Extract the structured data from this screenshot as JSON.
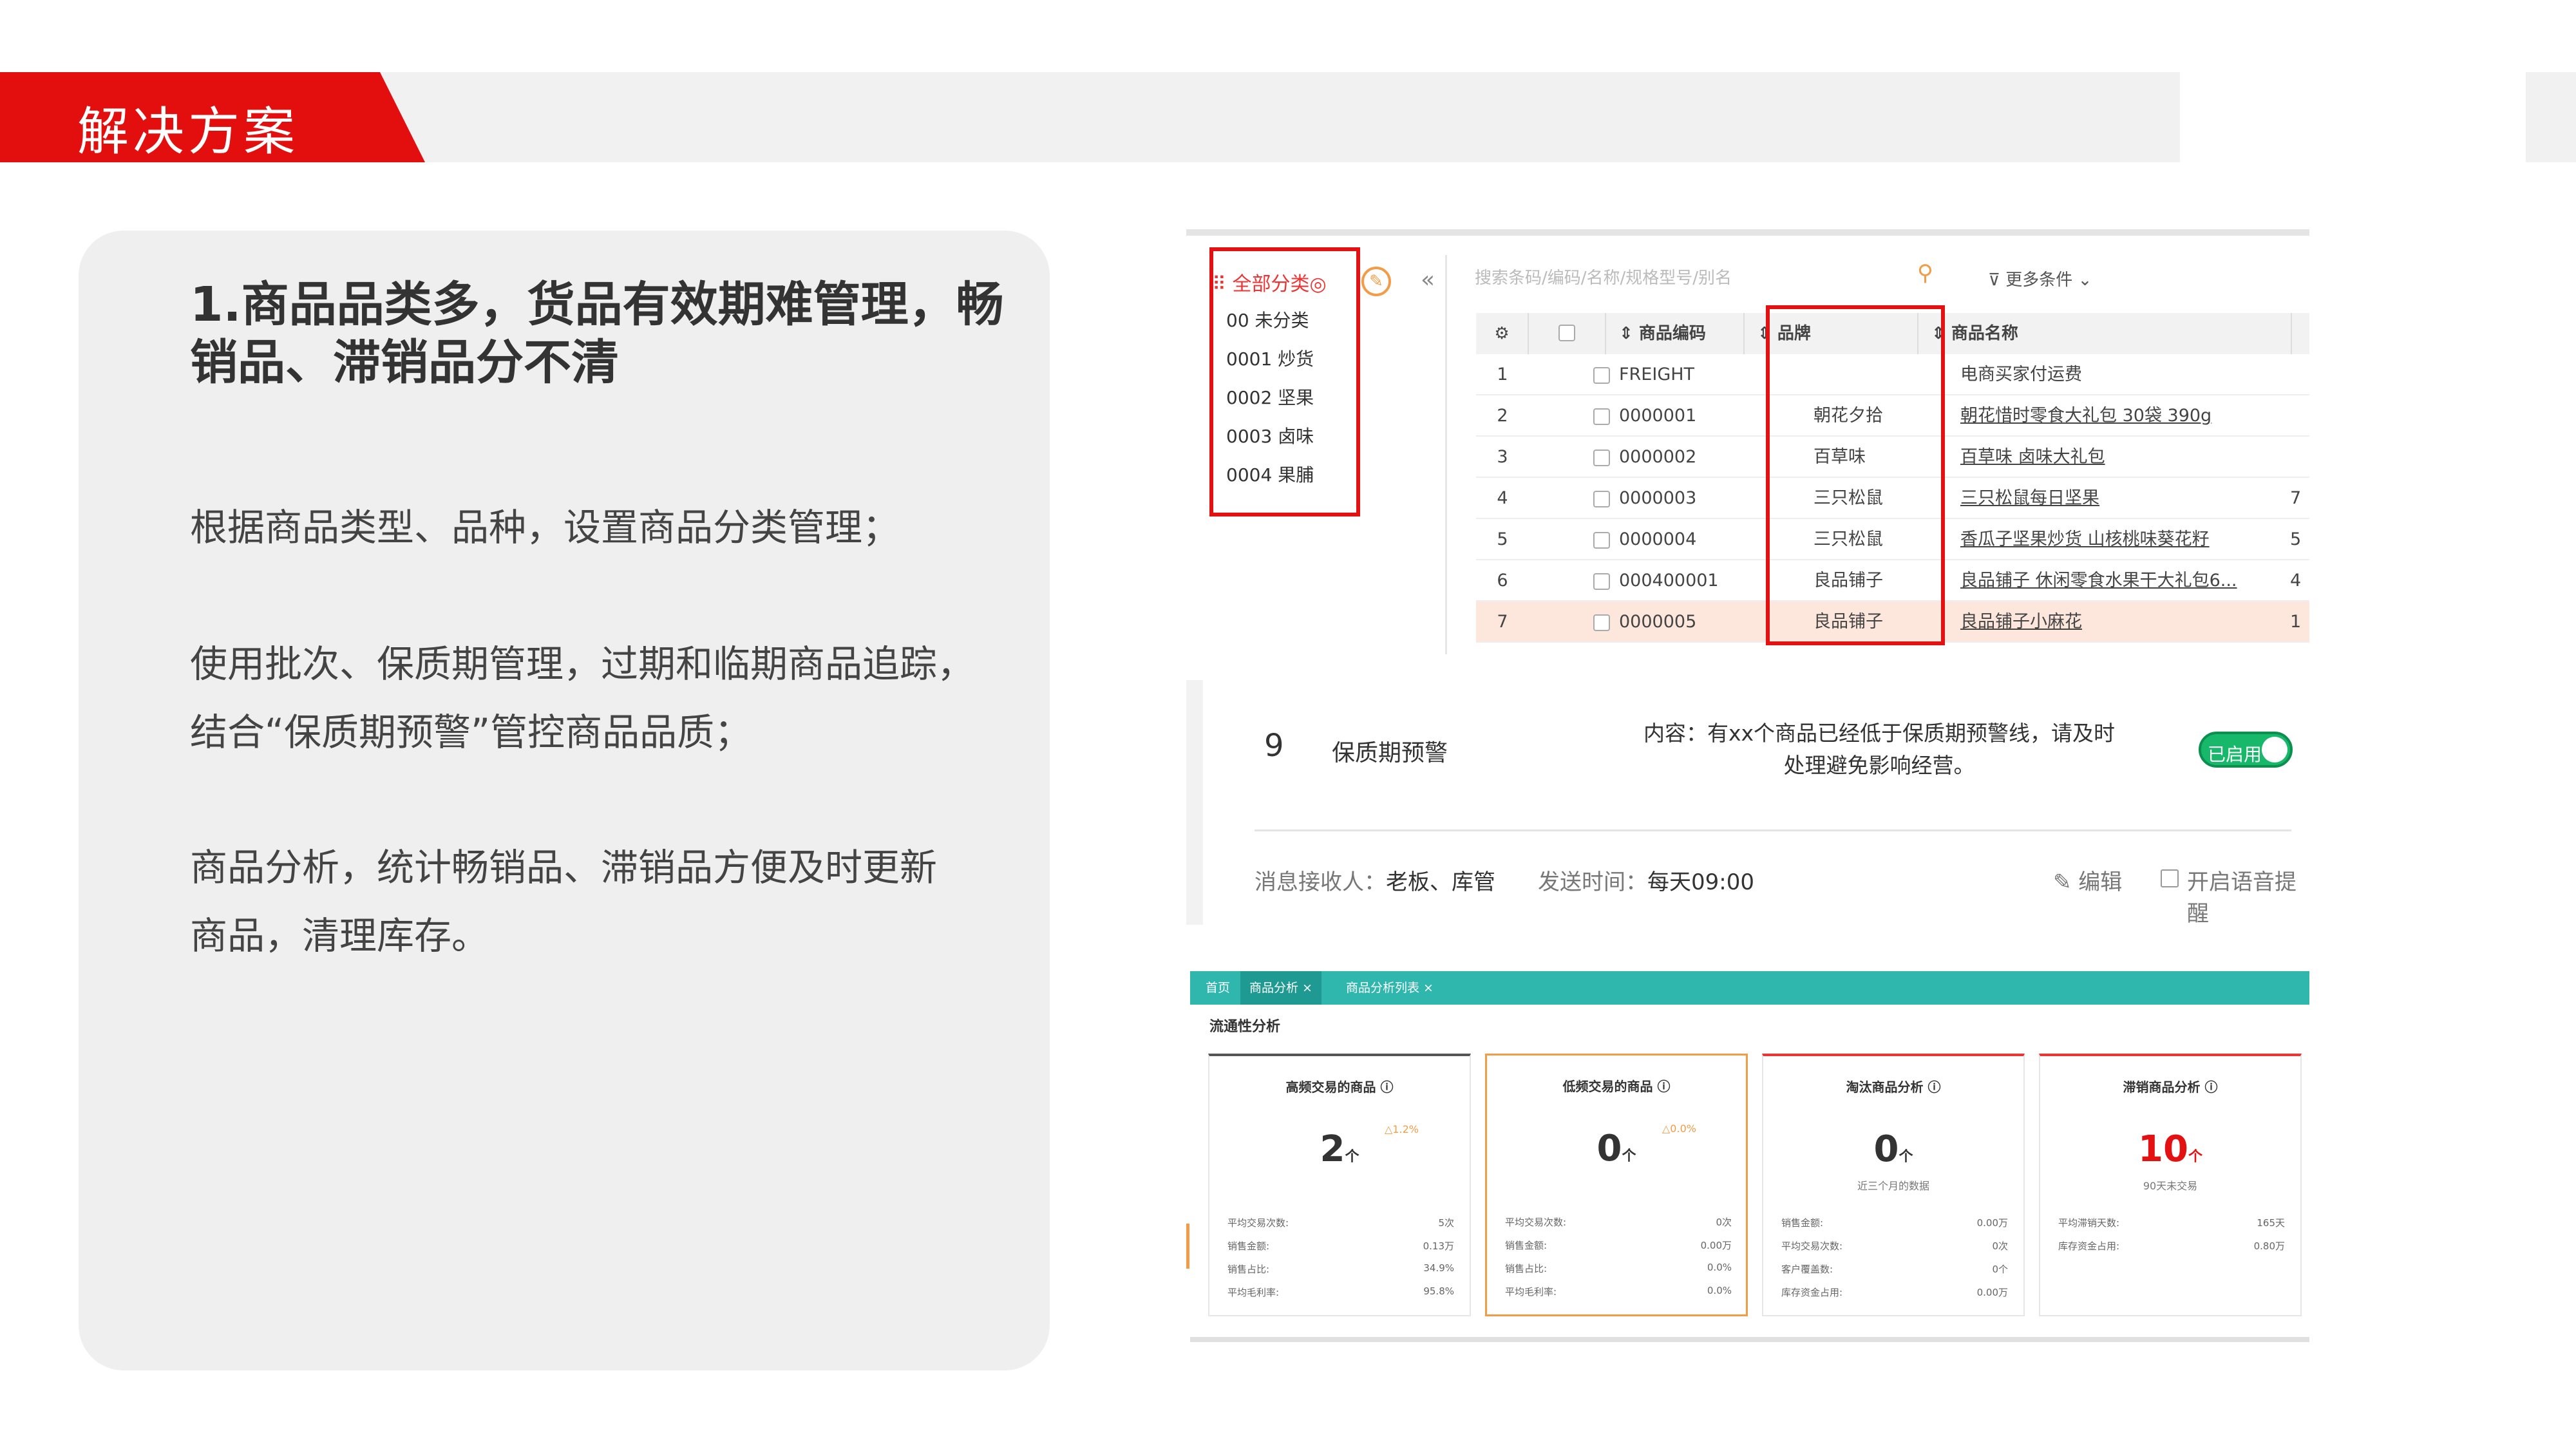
{
  "header": {
    "title": "解决方案"
  },
  "card": {
    "title": "1.商品品类多，货品有效期难管理，畅销品、滞销品分不清",
    "paragraphs": [
      "根据商品类型、品种，设置商品分类管理；",
      "使用批次、保质期管理，过期和临期商品追踪，结合“保质期预警”管控商品品质；",
      "商品分析，统计畅销品、滞销品方便及时更新商品，清理库存。"
    ]
  },
  "product_table": {
    "categories": [
      "全部分类◎",
      "00 未分类",
      "0001 炒货",
      "0002 坚果",
      "0003 卤味",
      "0004 果脯"
    ],
    "search_placeholder": "搜索条码/编码/名称/规格型号/别名",
    "more_filters": "更多条件",
    "columns": [
      "商品编码",
      "品牌",
      "商品名称"
    ],
    "rows": [
      {
        "no": "1",
        "code": "FREIGHT",
        "brand": "",
        "name": "电商买家付运费",
        "extra": ""
      },
      {
        "no": "2",
        "code": "0000001",
        "brand": "朝花夕拾",
        "name": "朝花惜时零食大礼包 30袋 390g",
        "extra": ""
      },
      {
        "no": "3",
        "code": "0000002",
        "brand": "百草味",
        "name": "百草味 卤味大礼包",
        "extra": ""
      },
      {
        "no": "4",
        "code": "0000003",
        "brand": "三只松鼠",
        "name": "三只松鼠每日坚果",
        "extra": "7"
      },
      {
        "no": "5",
        "code": "0000004",
        "brand": "三只松鼠",
        "name": "香瓜子坚果炒货 山核桃味葵花籽",
        "extra": "5"
      },
      {
        "no": "6",
        "code": "000400001",
        "brand": "良品铺子",
        "name": "良品铺子 休闲零食水果干大礼包6...",
        "extra": "4"
      },
      {
        "no": "7",
        "code": "0000005",
        "brand": "良品铺子",
        "name": "良品铺子小麻花",
        "extra": "1"
      }
    ]
  },
  "warning_rule": {
    "number": "9",
    "name": "保质期预警",
    "content": "内容：有xx个商品已经低于保质期预警线，请及时处理避免影响经营。",
    "toggle_label": "已启用",
    "receiver_label": "消息接收人：",
    "receiver_value": "老板、库管",
    "time_label": "发送时间：",
    "time_value": "每天09:00",
    "edit_label": "编辑",
    "voice_label": "开启语音提醒"
  },
  "analysis": {
    "tabs": [
      "首页",
      "商品分析 ×",
      "商品分析列表 ×"
    ],
    "section_title": "流通性分析",
    "cards": [
      {
        "title": "高频交易的商品 ⓘ",
        "value": "2",
        "unit": "个",
        "badge": "△1.2%",
        "note": "",
        "rows": [
          [
            "平均交易次数:",
            "5次"
          ],
          [
            "销售金额:",
            "0.13万"
          ],
          [
            "销售占比:",
            "34.9%"
          ],
          [
            "平均毛利率:",
            "95.8%"
          ]
        ]
      },
      {
        "title": "低频交易的商品 ⓘ",
        "value": "0",
        "unit": "个",
        "badge": "△0.0%",
        "note": "",
        "rows": [
          [
            "平均交易次数:",
            "0次"
          ],
          [
            "销售金额:",
            "0.00万"
          ],
          [
            "销售占比:",
            "0.0%"
          ],
          [
            "平均毛利率:",
            "0.0%"
          ]
        ]
      },
      {
        "title": "淘汰商品分析 ⓘ",
        "value": "0",
        "unit": "个",
        "badge": "",
        "note": "近三个月的数据",
        "rows": [
          [
            "销售金额:",
            "0.00万"
          ],
          [
            "平均交易次数:",
            "0次"
          ],
          [
            "客户覆盖数:",
            "0个"
          ],
          [
            "库存资金占用:",
            "0.00万"
          ]
        ]
      },
      {
        "title": "滞销商品分析 ⓘ",
        "value": "10",
        "unit": "个",
        "badge": "",
        "note": "90天未交易",
        "rows": [
          [
            "平均滞销天数:",
            "165天"
          ],
          [
            "库存资金占用:",
            "0.80万"
          ]
        ]
      }
    ]
  },
  "colors": {
    "brand_red": "#e30f0f",
    "teal": "#2fb7ae",
    "orange": "#f39c47",
    "green": "#17b86a"
  }
}
